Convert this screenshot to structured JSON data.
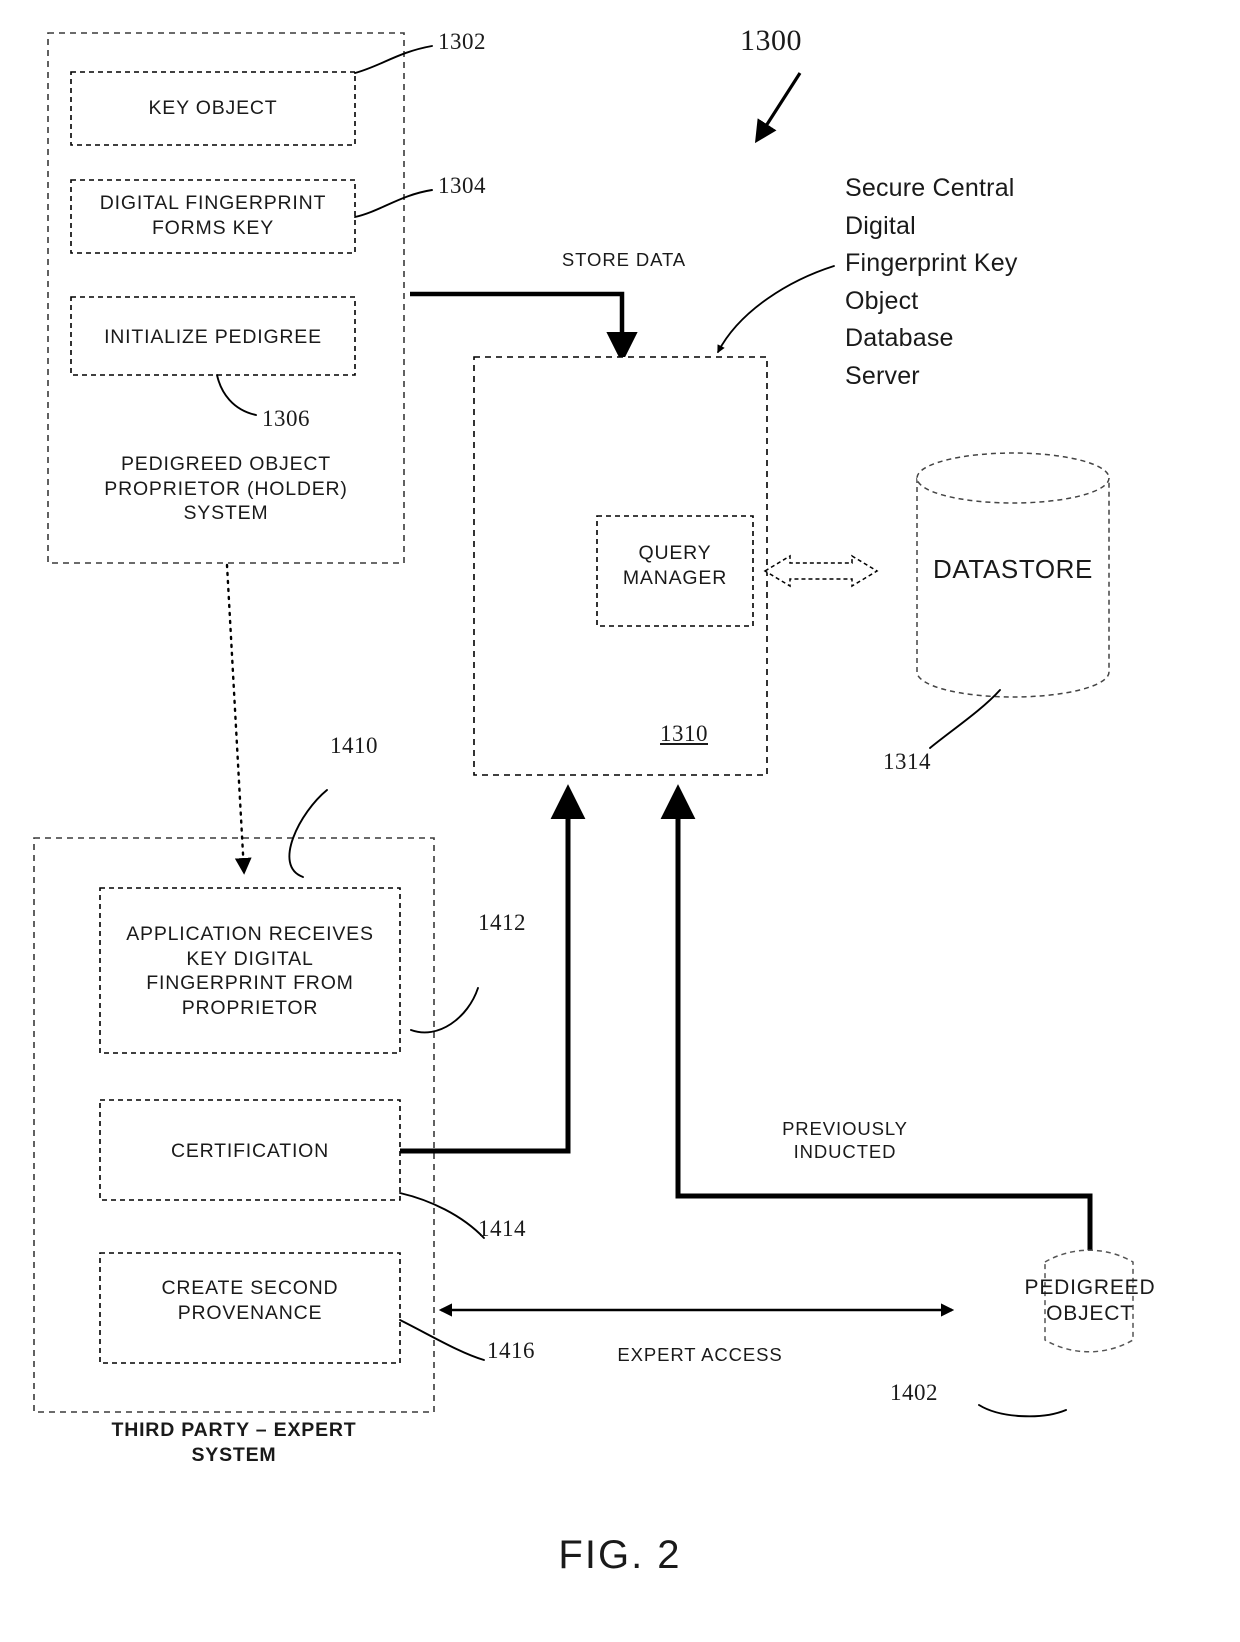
{
  "figure": {
    "caption": "FIG. 2",
    "main_ref": "1300"
  },
  "holder_system": {
    "label": "PEDIGREED OBJECT\nPROPRIETOR (HOLDER)\nSYSTEM",
    "boxes": [
      {
        "label": "KEY OBJECT",
        "ref": "1302"
      },
      {
        "label": "DIGITAL FINGERPRINT\nFORMS KEY",
        "ref": "1304"
      },
      {
        "label": "INITIALIZE PEDIGREE",
        "ref": "1306"
      }
    ]
  },
  "server": {
    "caption": "Secure Central\nDigital\nFingerprint Key\nObject\nDatabase\nServer",
    "ref": "1310",
    "query_manager": {
      "label": "QUERY\nMANAGER"
    }
  },
  "datastore": {
    "label": "DATASTORE",
    "ref": "1314"
  },
  "expert_system": {
    "label": "THIRD PARTY – EXPERT\nSYSTEM",
    "ref": "1410",
    "boxes": [
      {
        "label": "APPLICATION RECEIVES\nKEY DIGITAL\nFINGERPRINT FROM\nPROPRIETOR",
        "ref": "1412"
      },
      {
        "label": "CERTIFICATION",
        "ref": "1414"
      },
      {
        "label": "CREATE SECOND\nPROVENANCE",
        "ref": "1416"
      }
    ]
  },
  "pedigreed_object": {
    "label": "PEDIGREED\nOBJECT",
    "ref": "1402"
  },
  "flows": {
    "store_data": "STORE DATA",
    "previously_inducted": "PREVIOUSLY\nINDUCTED",
    "expert_access": "EXPERT ACCESS"
  },
  "colors": {
    "ink": "#1a1a1a",
    "line": "#000000",
    "background": "#ffffff"
  }
}
